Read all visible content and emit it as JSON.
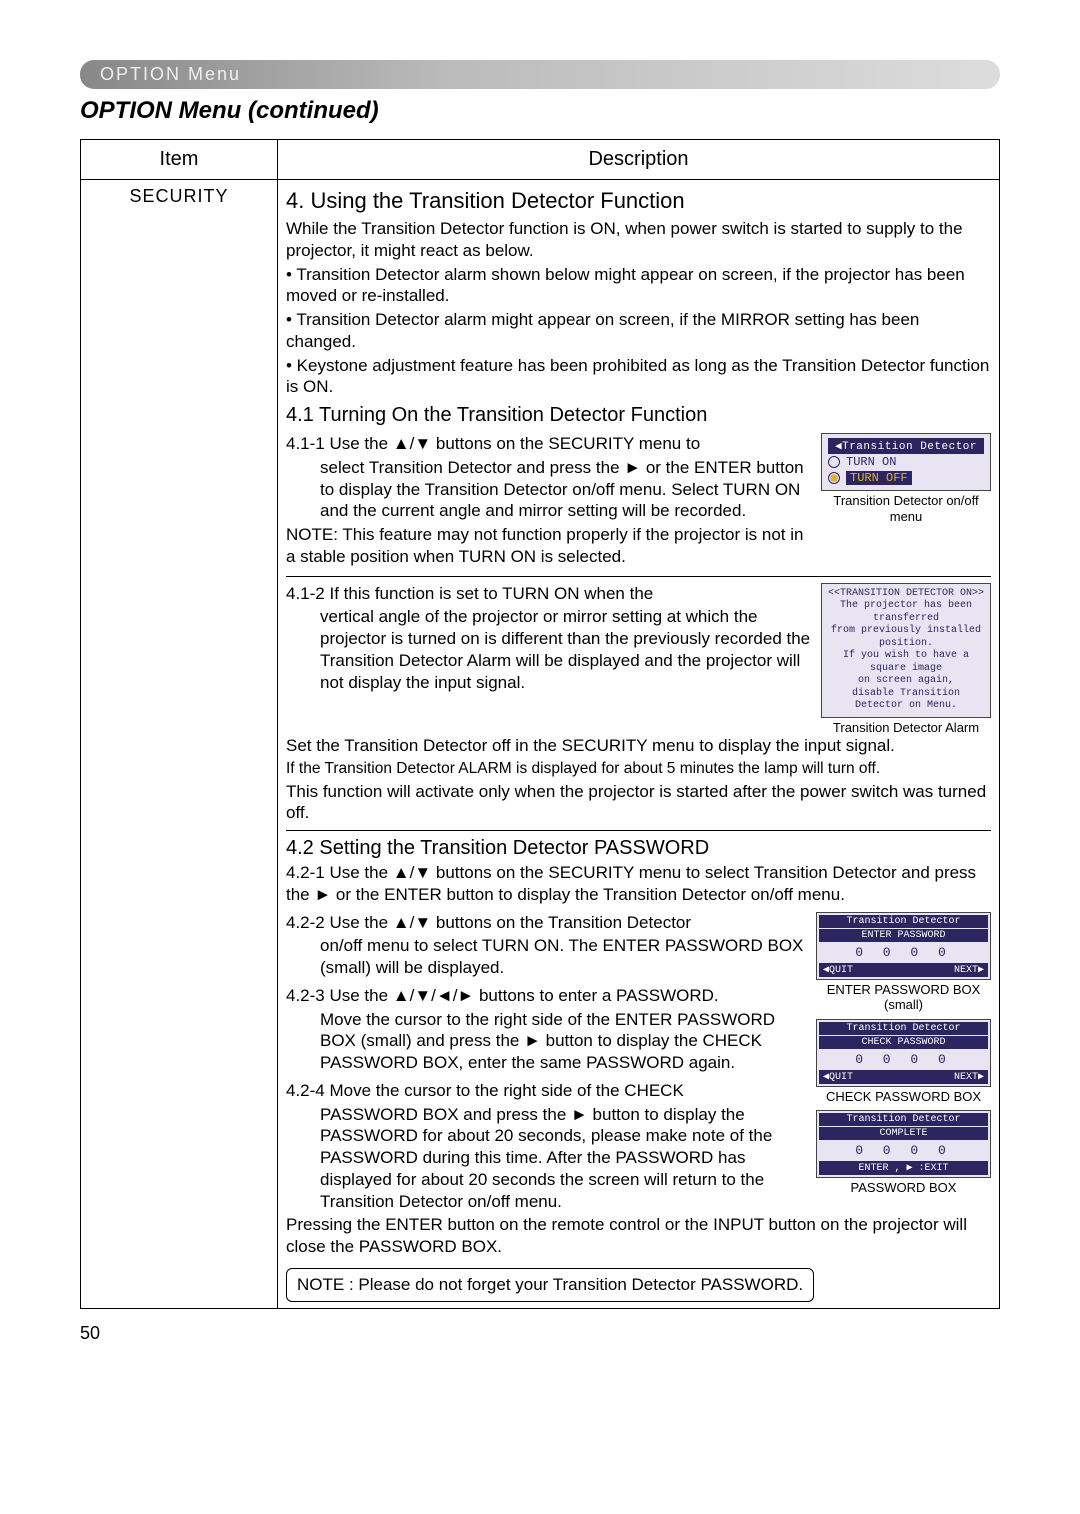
{
  "breadcrumb": "OPTION Menu",
  "section_title": "OPTION Menu (continued)",
  "table": {
    "header_item": "Item",
    "header_desc": "Description",
    "item": "SECURITY"
  },
  "s4": {
    "title": "4. Using the Transition Detector Function",
    "intro1": "While the Transition Detector function is ON, when power switch is started to supply to the projector, it might react as below.",
    "b1": "• Transition Detector alarm shown below might appear on screen, if the projector has been moved or re-installed.",
    "b2": "• Transition Detector alarm might appear on screen, if the MIRROR setting has been changed.",
    "b3": "• Keystone adjustment feature has been prohibited as long as the Transition Detector function is ON."
  },
  "s41": {
    "title": "4.1 Turning On the Transition Detector Function",
    "p411a": "4.1-1 Use the ▲/▼ buttons on the SECURITY menu to",
    "p411b": "select Transition Detector and press the ► or the ENTER button to display the Transition Detector on/off menu. Select TURN ON and the current angle and mirror setting will be recorded.",
    "p411c": "NOTE: This feature may not function properly if the projector is not in a stable position when TURN ON is selected.",
    "p412a": "4.1-2 If this function is set to TURN ON when the",
    "p412b": "vertical angle of the projector or mirror setting at which the projector is turned on is different than the previously recorded the Transition Detector Alarm will be displayed and the projector will not display the input signal.",
    "p412c": "Set the Transition Detector off in the SECURITY menu to display the input signal.",
    "p412d": "If the Transition Detector ALARM is displayed for about 5 minutes the lamp will turn off.",
    "p412e": "This function will activate only when the projector is started after the power switch was turned off."
  },
  "fig_onoff": {
    "hdr": "◀Transition Detector",
    "opt_on": "TURN ON",
    "opt_off": "TURN OFF",
    "caption": "Transition Detector on/off menu"
  },
  "fig_alarm": {
    "hdr": "<<TRANSITION DETECTOR ON>>",
    "l1": "The projector has been transferred",
    "l2": "from previously installed position.",
    "l3": "If you wish to have a square image",
    "l4": "on screen again,",
    "l5": "disable Transition Detector on Menu.",
    "caption": "Transition Detector Alarm"
  },
  "s42": {
    "title": "4.2 Setting the Transition Detector PASSWORD",
    "p421": "4.2-1 Use the ▲/▼ buttons on the SECURITY menu to select Transition Detector and press the ► or the ENTER button to display the Transition Detector on/off menu.",
    "p422a": "4.2-2 Use the ▲/▼ buttons on the Transition Detector",
    "p422b": "on/off menu to select TURN ON. The ENTER PASSWORD BOX (small) will be displayed.",
    "p423a": "4.2-3 Use the ▲/▼/◄/► buttons to enter a PASSWORD.",
    "p423b": "Move the cursor to the right side of the ENTER PASSWORD BOX (small) and press the ► button to display the CHECK PASSWORD BOX, enter the same PASSWORD again.",
    "p424a": "4.2-4 Move the cursor to the right side of the CHECK",
    "p424b": "PASSWORD BOX and press the ► button to display the PASSWORD for about 20 seconds, please make note of the PASSWORD during this time. After the PASSWORD has displayed for about 20 seconds the screen will return to the Transition Detector on/off menu.",
    "p424c": "Pressing the ENTER button on the remote control or the INPUT button on the projector will close the PASSWORD BOX.",
    "note": "NOTE : Please do not forget your Transition Detector PASSWORD."
  },
  "fig_enter": {
    "hdr": "Transition Detector",
    "sub": "ENTER PASSWORD",
    "digits": "0 0 0 0",
    "quit": "QUIT",
    "next": "NEXT",
    "caption": "ENTER PASSWORD BOX (small)"
  },
  "fig_check": {
    "hdr": "Transition Detector",
    "sub": "CHECK PASSWORD",
    "digits": "0 0 0 0",
    "quit": "QUIT",
    "next": "NEXT",
    "caption": "CHECK PASSWORD BOX"
  },
  "fig_complete": {
    "hdr": "Transition Detector",
    "sub": "COMPLETE",
    "digits": "0 0 0 0",
    "exit": "ENTER , ▶ :EXIT",
    "caption": "PASSWORD BOX"
  },
  "page_number": "50"
}
